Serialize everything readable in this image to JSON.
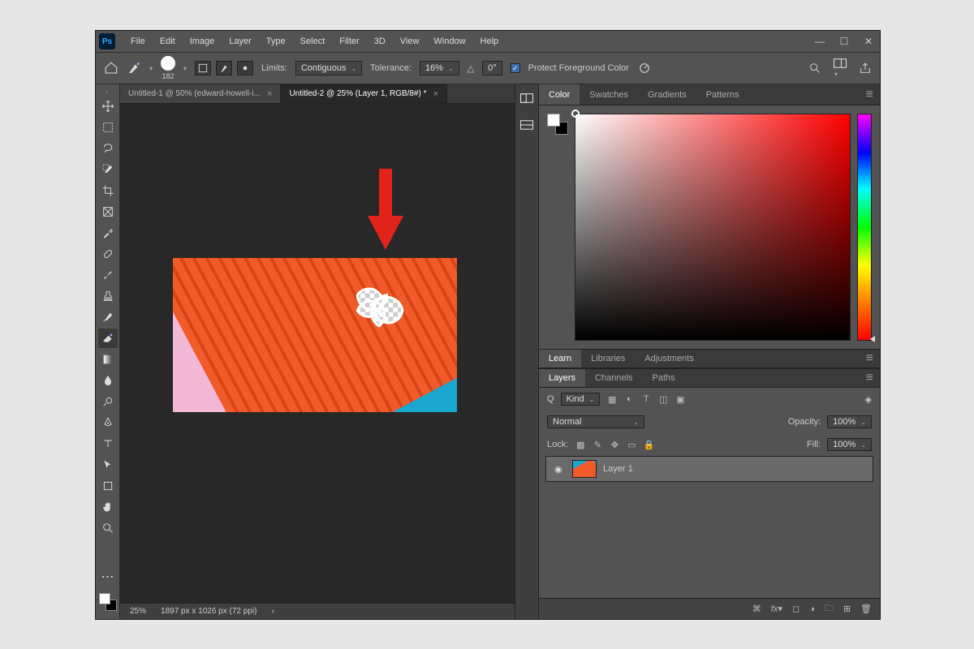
{
  "menubar": {
    "items": [
      "File",
      "Edit",
      "Image",
      "Layer",
      "Type",
      "Select",
      "Filter",
      "3D",
      "View",
      "Window",
      "Help"
    ]
  },
  "optbar": {
    "brush_size": "182",
    "limits_label": "Limits:",
    "limits_value": "Contiguous",
    "tolerance_label": "Tolerance:",
    "tolerance_value": "16%",
    "angle_icon": "△",
    "angle_value": "0°",
    "protect_label": "Protect Foreground Color"
  },
  "doc_tabs": [
    {
      "label": "Untitled-1 @ 50% (edward-howell-i...",
      "active": false
    },
    {
      "label": "Untitled-2 @ 25% (Layer 1, RGB/8#) *",
      "active": true
    }
  ],
  "status": {
    "zoom": "25%",
    "dims": "1897 px x 1026 px (72 ppi)"
  },
  "panel_color_tabs": [
    "Color",
    "Swatches",
    "Gradients",
    "Patterns"
  ],
  "panel_mid_tabs": [
    "Learn",
    "Libraries",
    "Adjustments"
  ],
  "panel_layers_tabs": [
    "Layers",
    "Channels",
    "Paths"
  ],
  "layers": {
    "kind_label": "Kind",
    "blend_mode": "Normal",
    "opacity_label": "Opacity:",
    "opacity_value": "100%",
    "lock_label": "Lock:",
    "fill_label": "Fill:",
    "fill_value": "100%",
    "layer1_name": "Layer 1",
    "search_icon": "Q"
  }
}
